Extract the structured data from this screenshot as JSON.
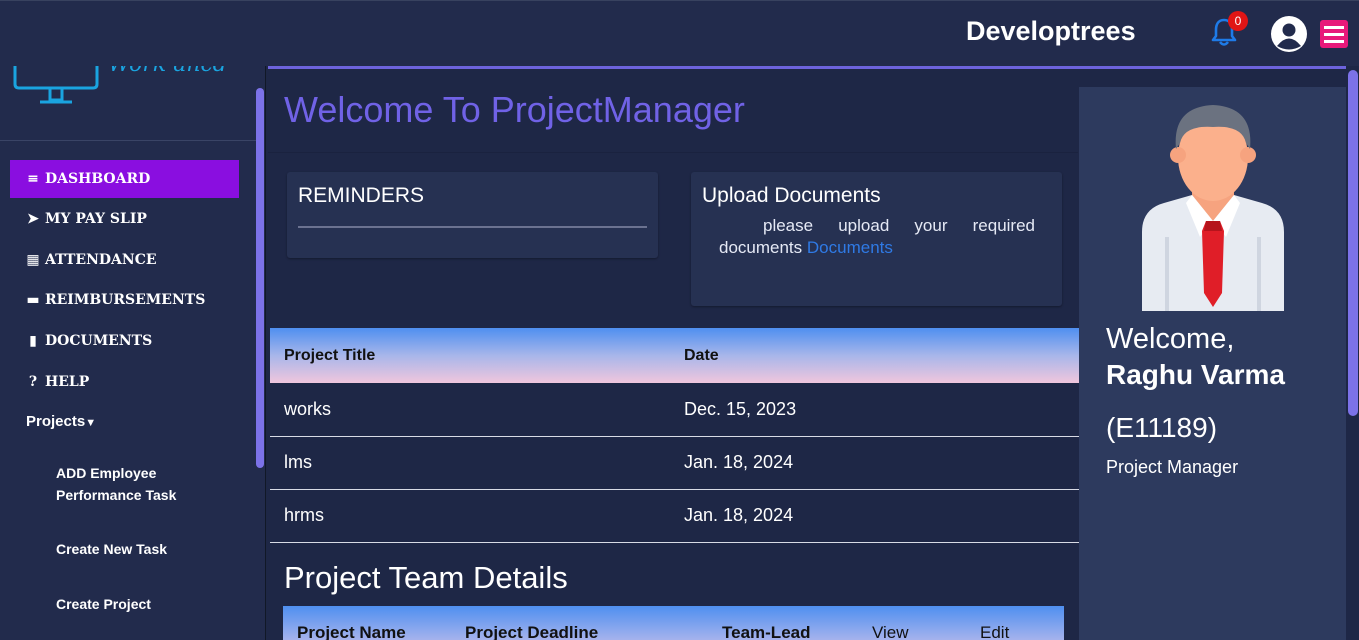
{
  "header": {
    "brand": "Developtrees",
    "notification_count": "0"
  },
  "sidebar": {
    "logo_text": "Work ancd",
    "items": [
      {
        "label": "DASHBOARD",
        "icon": "bars-icon"
      },
      {
        "label": "MY PAY SLIP",
        "icon": "paper-plane-icon"
      },
      {
        "label": "ATTENDANCE",
        "icon": "calendar-icon"
      },
      {
        "label": "REIMBURSEMENTS",
        "icon": "credit-card-icon"
      },
      {
        "label": "DOCUMENTS",
        "icon": "file-icon"
      },
      {
        "label": "HELP",
        "icon": "question-circle-icon"
      }
    ],
    "projects_label": "Projects",
    "project_items": [
      "ADD Employee Performance Task",
      "Create New Task",
      "Create Project"
    ]
  },
  "main": {
    "title": "Welcome To ProjectManager",
    "reminders_title": "REMINDERS",
    "upload_title": "Upload Documents",
    "upload_text": "please upload your required documents",
    "upload_link": "Documents",
    "projects_table": {
      "headers": [
        "Project Title",
        "Date"
      ],
      "rows": [
        [
          "works",
          "Dec. 15, 2023"
        ],
        [
          "lms",
          "Jan. 18, 2024"
        ],
        [
          "hrms",
          "Jan. 18, 2024"
        ]
      ]
    },
    "team_title": "Project Team Details",
    "team_headers": [
      "Project Name",
      "Project Deadline",
      "Team-Lead",
      "View",
      "Edit"
    ]
  },
  "profile": {
    "welcome": "Welcome,",
    "name": "Raghu Varma",
    "employee_id": "(E11189)",
    "role": "Project Manager"
  }
}
